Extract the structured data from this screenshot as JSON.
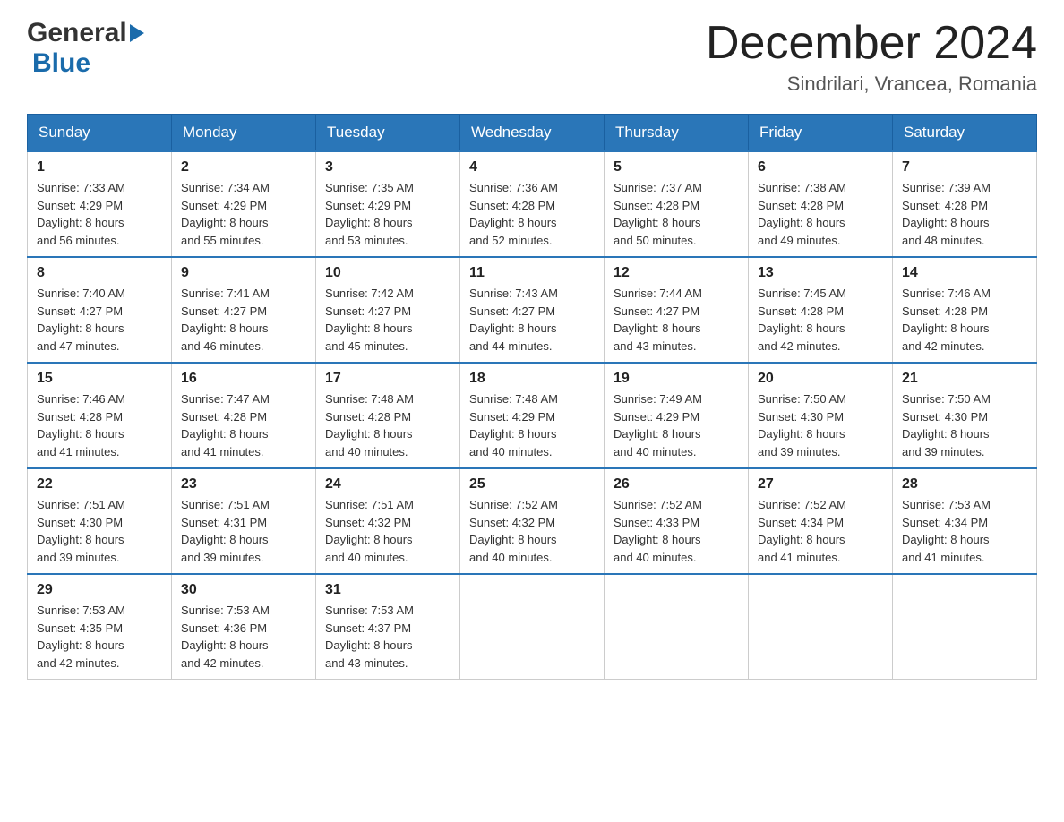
{
  "logo": {
    "text_general": "General",
    "text_blue": "Blue"
  },
  "header": {
    "month_title": "December 2024",
    "location": "Sindrilari, Vrancea, Romania"
  },
  "days_of_week": [
    "Sunday",
    "Monday",
    "Tuesday",
    "Wednesday",
    "Thursday",
    "Friday",
    "Saturday"
  ],
  "weeks": [
    [
      {
        "day": "1",
        "sunrise": "7:33 AM",
        "sunset": "4:29 PM",
        "daylight": "8 hours and 56 minutes."
      },
      {
        "day": "2",
        "sunrise": "7:34 AM",
        "sunset": "4:29 PM",
        "daylight": "8 hours and 55 minutes."
      },
      {
        "day": "3",
        "sunrise": "7:35 AM",
        "sunset": "4:29 PM",
        "daylight": "8 hours and 53 minutes."
      },
      {
        "day": "4",
        "sunrise": "7:36 AM",
        "sunset": "4:28 PM",
        "daylight": "8 hours and 52 minutes."
      },
      {
        "day": "5",
        "sunrise": "7:37 AM",
        "sunset": "4:28 PM",
        "daylight": "8 hours and 50 minutes."
      },
      {
        "day": "6",
        "sunrise": "7:38 AM",
        "sunset": "4:28 PM",
        "daylight": "8 hours and 49 minutes."
      },
      {
        "day": "7",
        "sunrise": "7:39 AM",
        "sunset": "4:28 PM",
        "daylight": "8 hours and 48 minutes."
      }
    ],
    [
      {
        "day": "8",
        "sunrise": "7:40 AM",
        "sunset": "4:27 PM",
        "daylight": "8 hours and 47 minutes."
      },
      {
        "day": "9",
        "sunrise": "7:41 AM",
        "sunset": "4:27 PM",
        "daylight": "8 hours and 46 minutes."
      },
      {
        "day": "10",
        "sunrise": "7:42 AM",
        "sunset": "4:27 PM",
        "daylight": "8 hours and 45 minutes."
      },
      {
        "day": "11",
        "sunrise": "7:43 AM",
        "sunset": "4:27 PM",
        "daylight": "8 hours and 44 minutes."
      },
      {
        "day": "12",
        "sunrise": "7:44 AM",
        "sunset": "4:27 PM",
        "daylight": "8 hours and 43 minutes."
      },
      {
        "day": "13",
        "sunrise": "7:45 AM",
        "sunset": "4:28 PM",
        "daylight": "8 hours and 42 minutes."
      },
      {
        "day": "14",
        "sunrise": "7:46 AM",
        "sunset": "4:28 PM",
        "daylight": "8 hours and 42 minutes."
      }
    ],
    [
      {
        "day": "15",
        "sunrise": "7:46 AM",
        "sunset": "4:28 PM",
        "daylight": "8 hours and 41 minutes."
      },
      {
        "day": "16",
        "sunrise": "7:47 AM",
        "sunset": "4:28 PM",
        "daylight": "8 hours and 41 minutes."
      },
      {
        "day": "17",
        "sunrise": "7:48 AM",
        "sunset": "4:28 PM",
        "daylight": "8 hours and 40 minutes."
      },
      {
        "day": "18",
        "sunrise": "7:48 AM",
        "sunset": "4:29 PM",
        "daylight": "8 hours and 40 minutes."
      },
      {
        "day": "19",
        "sunrise": "7:49 AM",
        "sunset": "4:29 PM",
        "daylight": "8 hours and 40 minutes."
      },
      {
        "day": "20",
        "sunrise": "7:50 AM",
        "sunset": "4:30 PM",
        "daylight": "8 hours and 39 minutes."
      },
      {
        "day": "21",
        "sunrise": "7:50 AM",
        "sunset": "4:30 PM",
        "daylight": "8 hours and 39 minutes."
      }
    ],
    [
      {
        "day": "22",
        "sunrise": "7:51 AM",
        "sunset": "4:30 PM",
        "daylight": "8 hours and 39 minutes."
      },
      {
        "day": "23",
        "sunrise": "7:51 AM",
        "sunset": "4:31 PM",
        "daylight": "8 hours and 39 minutes."
      },
      {
        "day": "24",
        "sunrise": "7:51 AM",
        "sunset": "4:32 PM",
        "daylight": "8 hours and 40 minutes."
      },
      {
        "day": "25",
        "sunrise": "7:52 AM",
        "sunset": "4:32 PM",
        "daylight": "8 hours and 40 minutes."
      },
      {
        "day": "26",
        "sunrise": "7:52 AM",
        "sunset": "4:33 PM",
        "daylight": "8 hours and 40 minutes."
      },
      {
        "day": "27",
        "sunrise": "7:52 AM",
        "sunset": "4:34 PM",
        "daylight": "8 hours and 41 minutes."
      },
      {
        "day": "28",
        "sunrise": "7:53 AM",
        "sunset": "4:34 PM",
        "daylight": "8 hours and 41 minutes."
      }
    ],
    [
      {
        "day": "29",
        "sunrise": "7:53 AM",
        "sunset": "4:35 PM",
        "daylight": "8 hours and 42 minutes."
      },
      {
        "day": "30",
        "sunrise": "7:53 AM",
        "sunset": "4:36 PM",
        "daylight": "8 hours and 42 minutes."
      },
      {
        "day": "31",
        "sunrise": "7:53 AM",
        "sunset": "4:37 PM",
        "daylight": "8 hours and 43 minutes."
      },
      null,
      null,
      null,
      null
    ]
  ],
  "labels": {
    "sunrise": "Sunrise:",
    "sunset": "Sunset:",
    "daylight": "Daylight:"
  }
}
